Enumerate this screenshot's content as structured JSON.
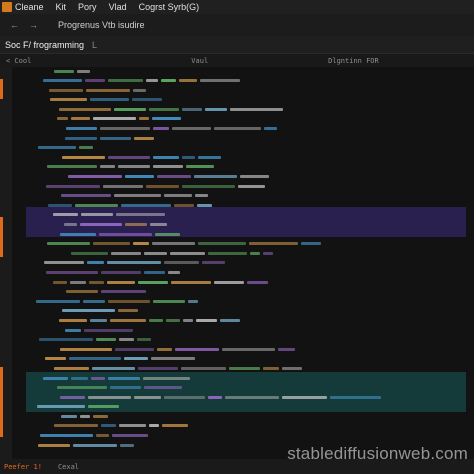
{
  "menubar": {
    "items": [
      "Cleane",
      "Kit",
      "Pory",
      "Vlad",
      "Cogrst Syrb(G)"
    ]
  },
  "toolbar": {
    "back": "←",
    "forward": "→",
    "program": "Progrenus Vtb isudire"
  },
  "tab": {
    "label": "Soc F/ frogramming",
    "close": "L"
  },
  "subbar": {
    "left": "< Cool",
    "mid": "Vaul",
    "right": "Dlgntinn FOR"
  },
  "status": {
    "key": "Peefer 1!",
    "value": "Cexal"
  },
  "watermark": "stablediffusionweb.com",
  "colors": {
    "accent": "#e06a1a",
    "background": "#121212"
  }
}
